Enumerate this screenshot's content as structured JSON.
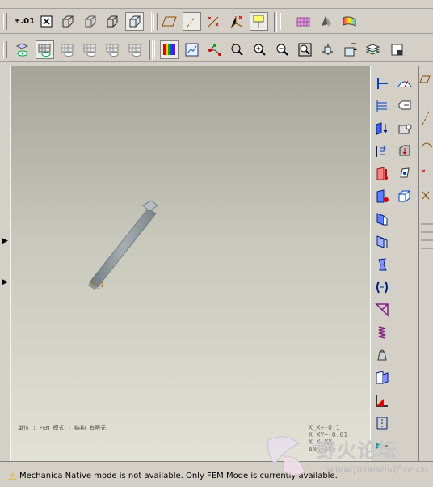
{
  "toolbar": {
    "tolerance_label": "±.01"
  },
  "viewport": {
    "model_label": "A_1",
    "units_caption": "单位 : FEM 模式 : 结构 有限元",
    "coords": [
      "X_X+-0.1",
      "X_XY+-0.01",
      "X_X XX",
      "ANS XX"
    ]
  },
  "status": {
    "message": "Mechanica Native mode is not available. Only FEM Mode is currently available."
  },
  "watermark": {
    "text": "野火论坛",
    "url": "www.proewildfire.cn"
  },
  "colors": {
    "chrome": "#d4d0c8",
    "viewport_top": "#a4a49a",
    "viewport_bottom": "#e1e1d5",
    "model": "#8d979c",
    "warning": "#e0b000"
  }
}
